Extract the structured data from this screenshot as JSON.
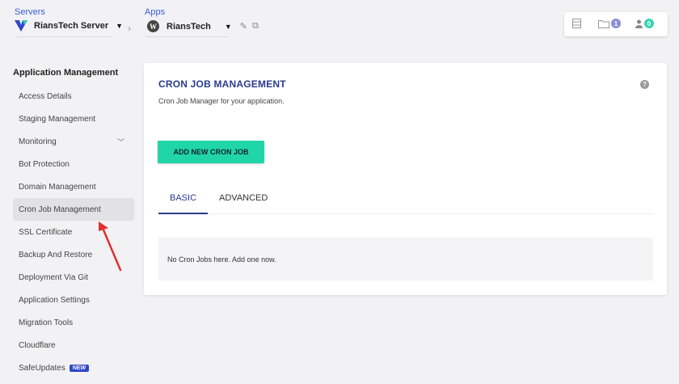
{
  "topbar": {
    "servers_label": "Servers",
    "server_name": "RiansTech Server",
    "apps_label": "Apps",
    "app_name": "RiansTech",
    "tray": {
      "folder_count": "1",
      "user_count": "0"
    }
  },
  "sidebar": {
    "heading": "Application Management",
    "items": [
      {
        "label": "Access Details"
      },
      {
        "label": "Staging Management"
      },
      {
        "label": "Monitoring"
      },
      {
        "label": "Bot Protection"
      },
      {
        "label": "Domain Management"
      },
      {
        "label": "Cron Job Management"
      },
      {
        "label": "SSL Certificate"
      },
      {
        "label": "Backup And Restore"
      },
      {
        "label": "Deployment Via Git"
      },
      {
        "label": "Application Settings"
      },
      {
        "label": "Migration Tools"
      },
      {
        "label": "Cloudflare"
      },
      {
        "label": "SafeUpdates",
        "badge": "NEW"
      }
    ]
  },
  "main": {
    "title": "CRON JOB MANAGEMENT",
    "subtitle": "Cron Job Manager for your application.",
    "add_button": "ADD NEW CRON JOB",
    "tabs": [
      {
        "label": "BASIC"
      },
      {
        "label": "ADVANCED"
      }
    ],
    "empty_message": "No Cron Jobs here. Add one now."
  },
  "colors": {
    "accent": "#2a3b8f",
    "button": "#20d6a8",
    "folder_badge": "#8b8fd6",
    "user_badge": "#3ad1b0",
    "arrow": "#e03030"
  }
}
